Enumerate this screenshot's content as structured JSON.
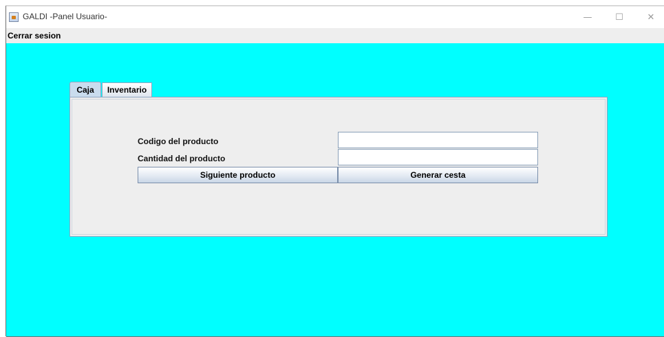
{
  "window": {
    "title": "GALDI -Panel Usuario-",
    "controls": {
      "minimize": "—",
      "maximize": "☐",
      "close": "✕"
    }
  },
  "menubar": {
    "items": [
      {
        "label": "Cerrar sesion"
      }
    ]
  },
  "tabs": [
    {
      "label": "Caja",
      "selected": true
    },
    {
      "label": "Inventario",
      "selected": false
    }
  ],
  "form": {
    "codigo_label": "Codigo del producto",
    "codigo_value": "",
    "cantidad_label": "Cantidad del producto",
    "cantidad_value": "",
    "siguiente_label": "Siguiente producto",
    "generar_label": "Generar cesta"
  },
  "colors": {
    "background": "#00ffff",
    "panel": "#eeeeee",
    "tab_selected": "#c9dcee"
  }
}
